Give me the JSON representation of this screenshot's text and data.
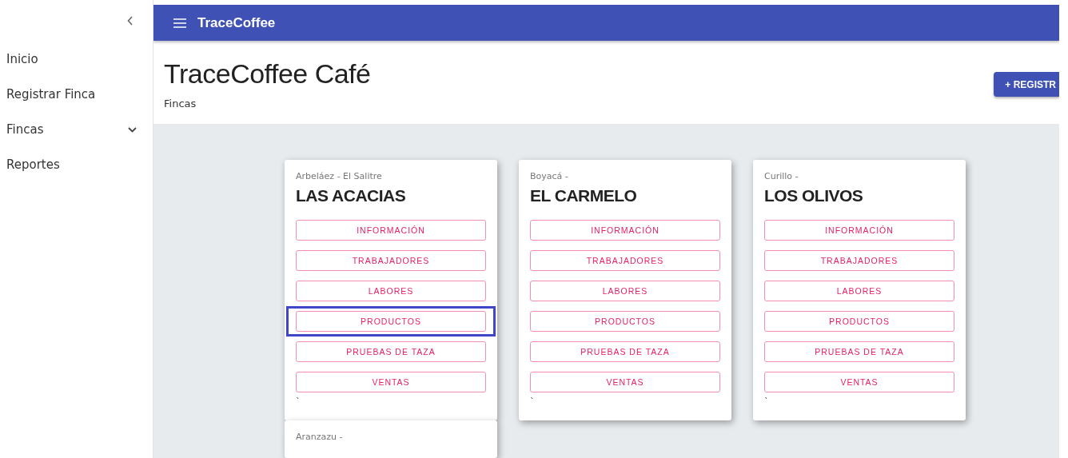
{
  "sidebar": {
    "items": [
      {
        "label": "Inicio",
        "expandable": false
      },
      {
        "label": "Registrar Finca",
        "expandable": false
      },
      {
        "label": "Fincas",
        "expandable": true
      },
      {
        "label": "Reportes",
        "expandable": false
      }
    ]
  },
  "app_bar": {
    "title": "TraceCoffee"
  },
  "header": {
    "title": "TraceCoffee Café",
    "subtitle": "Fincas",
    "action": "+ REGISTR"
  },
  "farms": [
    {
      "location": "Arbeláez - El Salitre",
      "name": "LAS ACACIAS",
      "note": "`",
      "buttons": [
        {
          "label": "INFORMACIÓN",
          "highlighted": false
        },
        {
          "label": "TRABAJADORES",
          "highlighted": false
        },
        {
          "label": "LABORES",
          "highlighted": false
        },
        {
          "label": "PRODUCTOS",
          "highlighted": true
        },
        {
          "label": "PRUEBAS DE TAZA",
          "highlighted": false
        },
        {
          "label": "VENTAS",
          "highlighted": false
        }
      ]
    },
    {
      "location": "Boyacá -",
      "name": "EL CARMELO",
      "note": "`",
      "buttons": [
        {
          "label": "INFORMACIÓN",
          "highlighted": false
        },
        {
          "label": "TRABAJADORES",
          "highlighted": false
        },
        {
          "label": "LABORES",
          "highlighted": false
        },
        {
          "label": "PRODUCTOS",
          "highlighted": false
        },
        {
          "label": "PRUEBAS DE TAZA",
          "highlighted": false
        },
        {
          "label": "VENTAS",
          "highlighted": false
        }
      ]
    },
    {
      "location": "Curillo -",
      "name": "LOS OLIVOS",
      "note": "`",
      "buttons": [
        {
          "label": "INFORMACIÓN",
          "highlighted": false
        },
        {
          "label": "TRABAJADORES",
          "highlighted": false
        },
        {
          "label": "LABORES",
          "highlighted": false
        },
        {
          "label": "PRODUCTOS",
          "highlighted": false
        },
        {
          "label": "PRUEBAS DE TAZA",
          "highlighted": false
        },
        {
          "label": "VENTAS",
          "highlighted": false
        }
      ]
    },
    {
      "location": "Aranzazu -"
    }
  ]
}
